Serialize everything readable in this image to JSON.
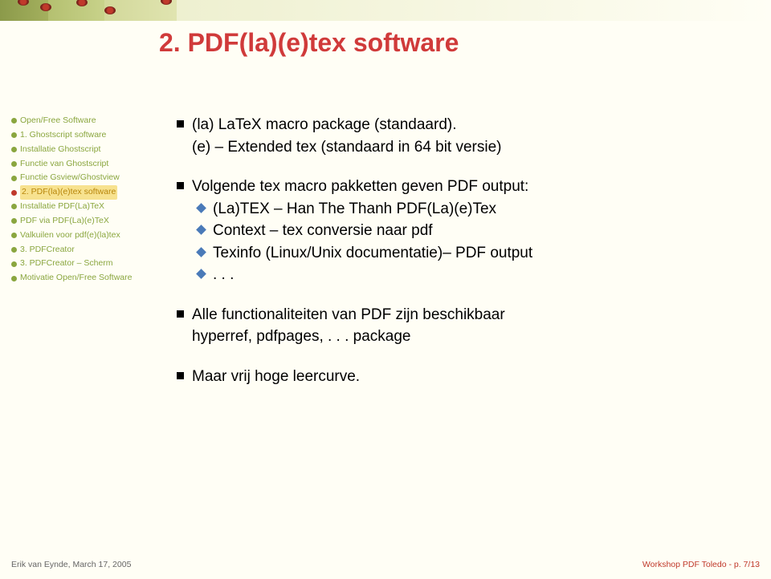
{
  "title": "2. PDF(la)(e)tex software",
  "sidebar": {
    "items": [
      {
        "label": "Open/Free Software",
        "active": false
      },
      {
        "label": "1. Ghostscript software",
        "active": false
      },
      {
        "label": "Installatie Ghostscript",
        "active": false
      },
      {
        "label": "Functie van Ghostscript",
        "active": false
      },
      {
        "label": "Functie Gsview/Ghostview",
        "active": false
      },
      {
        "label": "2. PDF(la)(e)tex software",
        "active": true
      },
      {
        "label": "Installatie PDF(La)TeX",
        "active": false
      },
      {
        "label": "PDF via PDF(La)(e)TeX",
        "active": false
      },
      {
        "label": "Valkuilen voor pdf(e)(la)tex",
        "active": false
      },
      {
        "label": "3. PDFCreator",
        "active": false
      },
      {
        "label": "3. PDFCreator – Scherm",
        "active": false
      },
      {
        "label": "Motivatie Open/Free Software",
        "active": false
      }
    ]
  },
  "content": {
    "intro1": "(la) LaTeX macro package (standaard).",
    "intro2": "(e) – Extended tex (standaard in 64 bit versie)",
    "line1": "Volgende tex macro pakketten geven PDF output:",
    "sub1": "(La)TEX – Han The Thanh PDF(La)(e)Tex",
    "sub2": "Context – tex conversie naar pdf",
    "sub3": "Texinfo (Linux/Unix documentatie)– PDF output",
    "sub4": ". . .",
    "line2a": "Alle functionaliteiten van PDF zijn beschikbaar",
    "line2b": "hyperref, pdfpages, . . . package",
    "line3": "Maar vrij hoge leercurve."
  },
  "footer": {
    "left": "Erik van Eynde, March 17, 2005",
    "right": "Workshop PDF Toledo - p. 7/13"
  }
}
